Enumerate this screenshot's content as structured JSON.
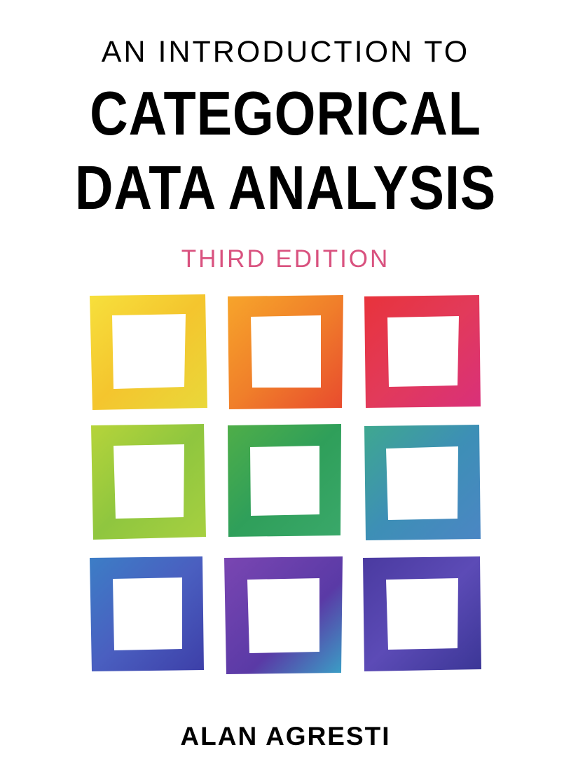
{
  "cover": {
    "series_line": "AN INTRODUCTION TO",
    "title_line_1": "CATEGORICAL",
    "title_line_2": "DATA ANALYSIS",
    "edition": "THIRD EDITION",
    "author": "ALAN AGRESTI"
  },
  "colors": {
    "edition_text": "#d9527f",
    "title_text": "#000000"
  },
  "artwork": {
    "squares": [
      {
        "name": "yellow",
        "colors": [
          "#f7e03c",
          "#f4c52e",
          "#e9d83a"
        ]
      },
      {
        "name": "orange",
        "colors": [
          "#f7a52b",
          "#f07f2a",
          "#e84a2e"
        ]
      },
      {
        "name": "red-pink",
        "colors": [
          "#e8333b",
          "#e23a5a",
          "#d9307a"
        ]
      },
      {
        "name": "light-green",
        "colors": [
          "#b6d43a",
          "#8fc63f",
          "#a7d040"
        ]
      },
      {
        "name": "green",
        "colors": [
          "#4fae48",
          "#2f9f5a",
          "#3aa86a"
        ]
      },
      {
        "name": "teal",
        "colors": [
          "#3fa88f",
          "#3d8fb6",
          "#4b86c4"
        ]
      },
      {
        "name": "blue",
        "colors": [
          "#3c7ec6",
          "#4a5fc0",
          "#3d3fa8"
        ]
      },
      {
        "name": "purple",
        "colors": [
          "#7a46b2",
          "#5a3aa6",
          "#3aa0c6"
        ]
      },
      {
        "name": "indigo",
        "colors": [
          "#4a3aa0",
          "#5c4bb6",
          "#3b3696"
        ]
      }
    ]
  }
}
